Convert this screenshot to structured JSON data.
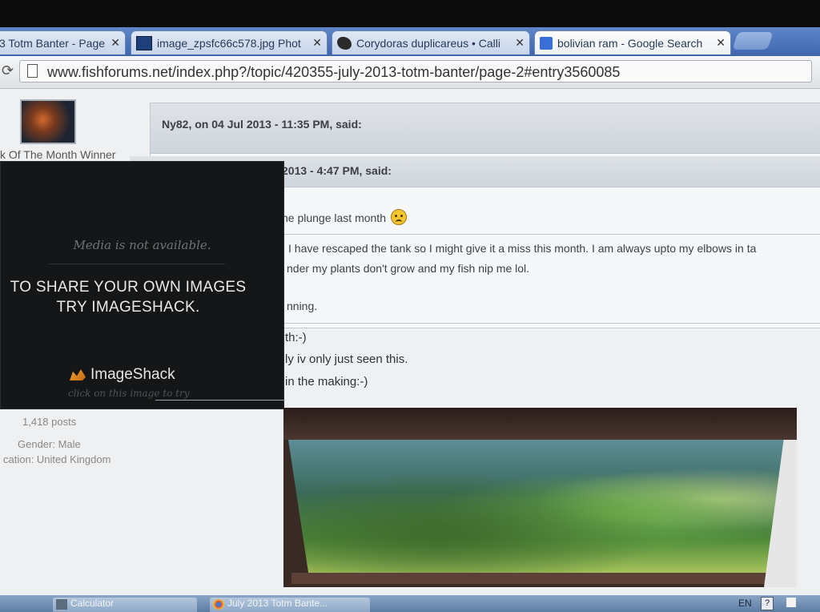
{
  "browser": {
    "tabs": [
      {
        "label": "3 Totm Banter - Page",
        "icon": "forum-icon"
      },
      {
        "label": "image_zpsfc66c578.jpg Phot",
        "icon": "photobucket-icon"
      },
      {
        "label": "Corydoras duplicareus • Calli",
        "icon": "fish-icon"
      },
      {
        "label": "bolivian ram - Google Search",
        "icon": "google-icon"
      }
    ],
    "close_glyph": "✕",
    "url": "www.fishforums.net/index.php?/topic/420355-july-2013-totm-banter/page-2#entry3560085"
  },
  "profile": {
    "title": "k Of The Month Winner",
    "posts": "1,418 posts",
    "gender": "Gender: Male",
    "location": "cation: United Kingdom"
  },
  "quote_outer": {
    "cite": "Ny82, on 04 Jul 2013 - 11:35 PM, said:"
  },
  "quote_inner": {
    "cite": "2013 - 4:47 PM, said:",
    "line1": "he plunge last month",
    "line2": "I have rescaped the tank so I might give it a miss this month. I am always upto my elbows in ta",
    "line3": "nder my plants don't grow and my fish nip me lol.",
    "line4": "nning."
  },
  "reply": {
    "line1": "th:-)",
    "line2": "ly iv only just seen this.",
    "line3": "in the making:-)"
  },
  "imageshack": {
    "media_unavailable": "Media is not available.",
    "share_line1": "TO SHARE YOUR OWN IMAGES",
    "share_line2": "TRY IMAGESHACK.",
    "logo_text": "ImageShack",
    "click_text": "click on this image to try"
  },
  "taskbar": {
    "items": [
      {
        "label": "Calculator",
        "icon": "calculator-icon"
      },
      {
        "label": "July 2013 Totm Bante...",
        "icon": "chrome-icon"
      }
    ],
    "language": "EN",
    "help": "?"
  }
}
